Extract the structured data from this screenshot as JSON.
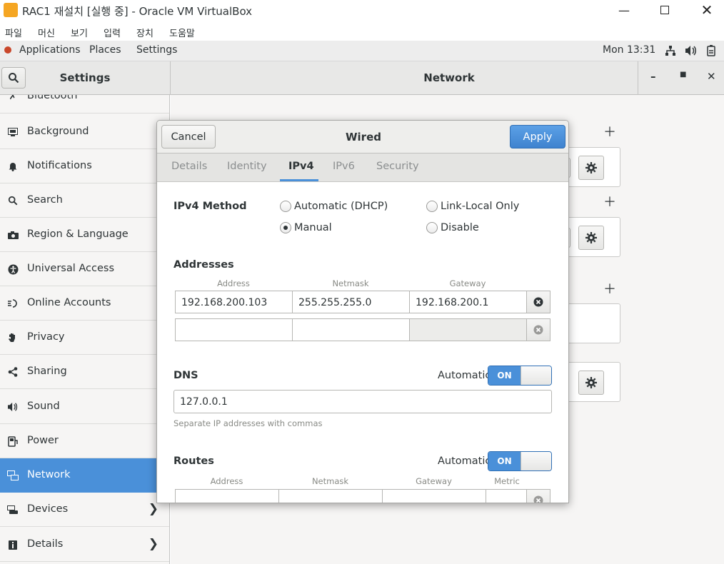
{
  "vbox": {
    "title": "RAC1 재설치 [실행 중] - Oracle VM VirtualBox",
    "menu": [
      "파일",
      "머신",
      "보기",
      "입력",
      "장치",
      "도움말"
    ]
  },
  "topbar": {
    "applications": "Applications",
    "places": "Places",
    "settings": "Settings",
    "clock": "Mon 13:31"
  },
  "header": {
    "left_title": "Settings",
    "right_title": "Network"
  },
  "sidebar": {
    "items": [
      {
        "label": "Bluetooth",
        "icon": "bluetooth-icon"
      },
      {
        "label": "Background",
        "icon": "background-icon"
      },
      {
        "label": "Notifications",
        "icon": "bell-icon"
      },
      {
        "label": "Search",
        "icon": "search-icon"
      },
      {
        "label": "Region & Language",
        "icon": "camera-icon"
      },
      {
        "label": "Universal Access",
        "icon": "accessibility-icon"
      },
      {
        "label": "Online Accounts",
        "icon": "online-accounts-icon"
      },
      {
        "label": "Privacy",
        "icon": "hand-icon"
      },
      {
        "label": "Sharing",
        "icon": "share-icon"
      },
      {
        "label": "Sound",
        "icon": "speaker-icon"
      },
      {
        "label": "Power",
        "icon": "power-icon"
      },
      {
        "label": "Network",
        "icon": "network-icon",
        "selected": true
      },
      {
        "label": "Devices",
        "icon": "devices-icon",
        "chevron": true
      },
      {
        "label": "Details",
        "icon": "info-icon",
        "chevron": true
      }
    ]
  },
  "dialog": {
    "title": "Wired",
    "cancel": "Cancel",
    "apply": "Apply",
    "tabs": [
      "Details",
      "Identity",
      "IPv4",
      "IPv6",
      "Security"
    ],
    "active_tab": "IPv4",
    "method_label": "IPv4 Method",
    "methods": {
      "auto": "Automatic (DHCP)",
      "link_local": "Link-Local Only",
      "manual": "Manual",
      "disable": "Disable"
    },
    "selected_method": "Manual",
    "addresses_label": "Addresses",
    "addr_cols": {
      "address": "Address",
      "netmask": "Netmask",
      "gateway": "Gateway"
    },
    "addresses": [
      {
        "address": "192.168.200.103",
        "netmask": "255.255.255.0",
        "gateway": "192.168.200.1"
      },
      {
        "address": "",
        "netmask": "",
        "gateway": ""
      }
    ],
    "dns_label": "DNS",
    "automatic_label": "Automatic",
    "switch_on": "ON",
    "dns_value": "127.0.0.1",
    "dns_hint": "Separate IP addresses with commas",
    "routes_label": "Routes",
    "route_cols": {
      "address": "Address",
      "netmask": "Netmask",
      "gateway": "Gateway",
      "metric": "Metric"
    }
  },
  "colors": {
    "accent": "#4a90d9",
    "sidebar_bg": "#f6f5f4"
  }
}
